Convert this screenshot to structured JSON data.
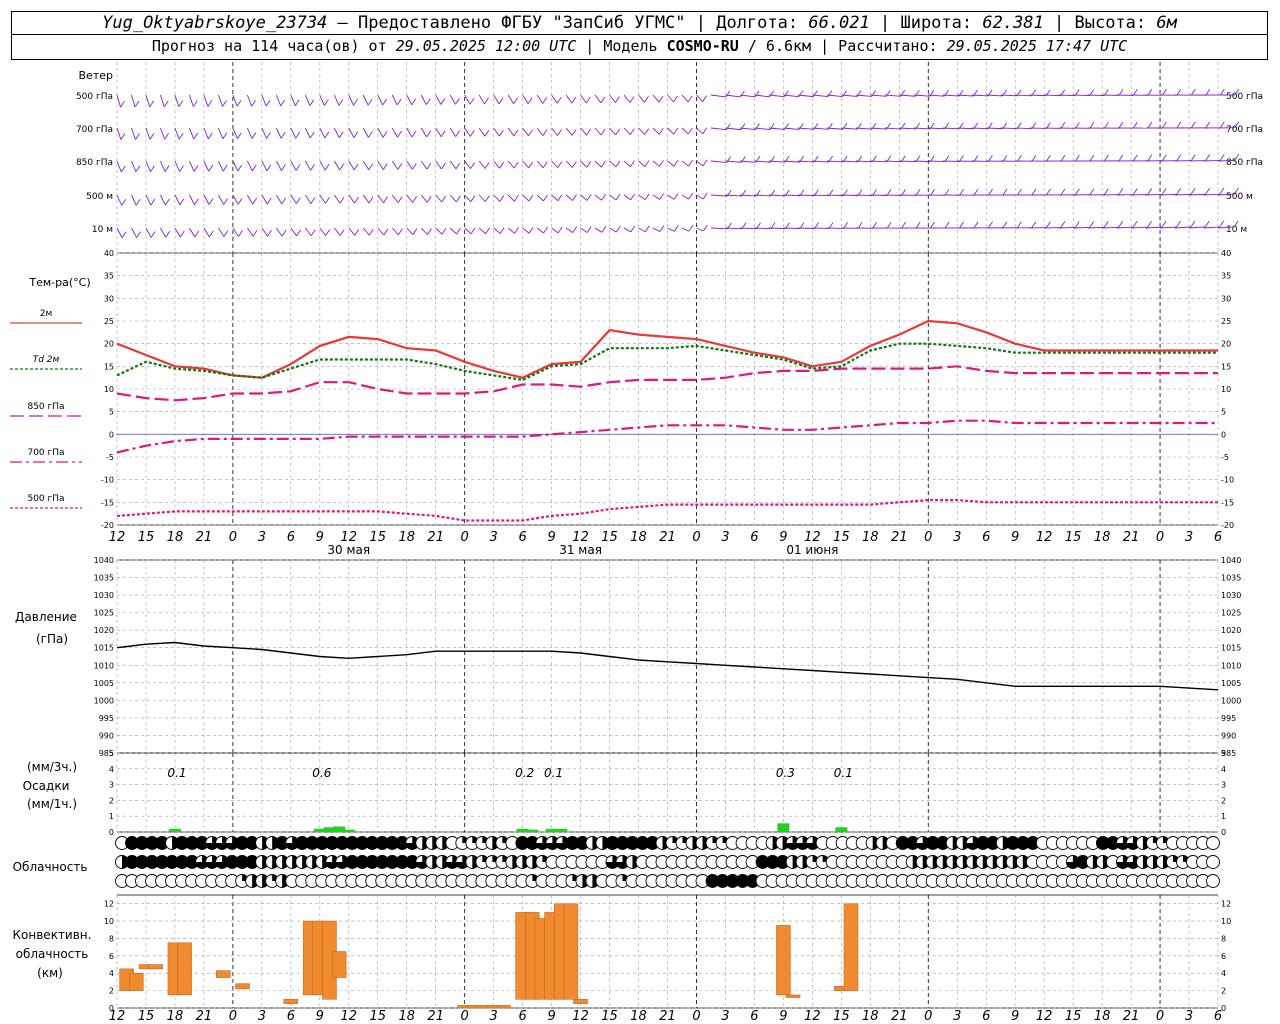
{
  "header": {
    "station": "Yug_Oktyabrskoye_23734",
    "provided_label": " – Предоставлено ФГБУ \"ЗапСиб УГМС\" | Долгота: ",
    "lon": "66.021",
    "lat_label": " | Широта: ",
    "lat": "62.381",
    "alt_label": " | Высота: ",
    "alt": "6м",
    "forecast_label": "Прогноз на 114 часа(ов) от ",
    "forecast_time": "29.05.2025 12:00 UTC",
    "model_label": " | Модель ",
    "model": "COSMO-RU",
    "resolution": " / 6.6км",
    "computed_label": " | Рассчитано: ",
    "computed_time": "29.05.2025 17:47 UTC"
  },
  "colors": {
    "t2m": "#e8393a",
    "td2m": "#117711",
    "t850": "#e0187a",
    "t700": "#e0187a",
    "t500": "#e0187a",
    "wind": "#8a1ec8",
    "pressure": "#000000",
    "precip": "#22d022",
    "convective": "#f08a30",
    "grid": "#a0a0a0"
  },
  "chart_data": [
    {
      "type": "wind-barbs",
      "title": "Ветер",
      "levels": [
        "500 гПа",
        "700 гПа",
        "850 гПа",
        "500 м",
        "10 м"
      ]
    },
    {
      "type": "line",
      "ylabel": "Тем-ра(°C)",
      "ylim": [
        -20,
        40
      ],
      "yticks": [
        -20,
        -15,
        -10,
        -5,
        0,
        5,
        10,
        15,
        20,
        25,
        30,
        35,
        40
      ],
      "x_hours": [
        0,
        3,
        6,
        9,
        12,
        15,
        18,
        21,
        24,
        27,
        30,
        33,
        36,
        39,
        42,
        45,
        48,
        51,
        54,
        57,
        60,
        63,
        66,
        69,
        72,
        75,
        78,
        81,
        84,
        87,
        90,
        93,
        96,
        99,
        102,
        105,
        108,
        111,
        114
      ],
      "tick_labels": [
        "12",
        "15",
        "18",
        "21",
        "0",
        "3",
        "6",
        "9",
        "12",
        "15",
        "18",
        "21",
        "0",
        "3",
        "6",
        "9",
        "12",
        "15",
        "18",
        "21",
        "0",
        "3",
        "6",
        "9",
        "12",
        "15",
        "18",
        "21",
        "0",
        "3",
        "6",
        "9",
        "12",
        "15",
        "18",
        "21",
        "0",
        "3",
        "6",
        "9",
        "12",
        "15",
        "18"
      ],
      "day_labels": [
        "30 мая",
        "31 мая",
        "01 июня"
      ],
      "series": [
        {
          "name": "2м",
          "style": "solid",
          "values": [
            20,
            17.5,
            15,
            14.5,
            13,
            12.5,
            15.5,
            19.5,
            21.5,
            21,
            19,
            18.5,
            16,
            14,
            12.5,
            15.5,
            16,
            23,
            22,
            21.5,
            21,
            19.5,
            18,
            17,
            15,
            16,
            19.5,
            22,
            25,
            24.5,
            22.5,
            20,
            18.5,
            18.5,
            18.5,
            18.5,
            18.5,
            18.5,
            18.5
          ]
        },
        {
          "name": "Td 2м",
          "style": "dotted",
          "values": [
            13,
            16,
            14.5,
            14,
            13,
            12.5,
            14.5,
            16.5,
            16.5,
            16.5,
            16.5,
            15.5,
            14,
            13,
            12,
            15,
            15.5,
            19,
            19,
            19,
            19.5,
            18.5,
            17.5,
            16.5,
            14.5,
            15,
            18.5,
            20,
            20,
            19.5,
            19,
            18,
            18,
            18,
            18,
            18,
            18,
            18,
            18
          ]
        },
        {
          "name": "850 гПа",
          "style": "dashed",
          "values": [
            9,
            8,
            7.5,
            8,
            9,
            9,
            9.5,
            11.5,
            11.5,
            10,
            9,
            9,
            9,
            9.5,
            11,
            11,
            10.5,
            11.5,
            12,
            12,
            12,
            12.5,
            13.5,
            14,
            14,
            14.5,
            14.5,
            14.5,
            14.5,
            15,
            14,
            13.5,
            13.5,
            13.5,
            13.5,
            13.5,
            13.5,
            13.5,
            13.5
          ]
        },
        {
          "name": "700 гПа",
          "style": "dashdot",
          "values": [
            -4,
            -2.5,
            -1.5,
            -1,
            -1,
            -1,
            -1,
            -1,
            -0.5,
            -0.5,
            -0.5,
            -0.5,
            -0.5,
            -0.5,
            -0.5,
            0,
            0.5,
            1,
            1.5,
            2,
            2,
            2,
            1.5,
            1,
            1,
            1.5,
            2,
            2.5,
            2.5,
            3,
            3,
            2.5,
            2.5,
            2.5,
            2.5,
            2.5,
            2.5,
            2.5,
            2.5
          ]
        },
        {
          "name": "500 гПа",
          "style": "dotted",
          "values": [
            -18,
            -17.5,
            -17,
            -17,
            -17,
            -17,
            -17,
            -17,
            -17,
            -17,
            -17.5,
            -18,
            -19,
            -19,
            -19,
            -18,
            -17.5,
            -16.5,
            -16,
            -15.5,
            -15.5,
            -15.5,
            -15.5,
            -15.5,
            -15.5,
            -15.5,
            -15.5,
            -15,
            -14.5,
            -14.5,
            -15,
            -15,
            -15,
            -15,
            -15,
            -15,
            -15,
            -15,
            -15
          ]
        }
      ]
    },
    {
      "type": "line",
      "title": "Давление",
      "ylabel": "(гПа)",
      "ylim": [
        985,
        1040
      ],
      "yticks": [
        985,
        990,
        995,
        1000,
        1005,
        1010,
        1015,
        1020,
        1025,
        1030,
        1035,
        1040
      ],
      "x_hours": [
        0,
        3,
        6,
        9,
        12,
        15,
        18,
        21,
        24,
        27,
        30,
        33,
        36,
        39,
        42,
        45,
        48,
        51,
        54,
        57,
        60,
        63,
        66,
        69,
        72,
        75,
        78,
        81,
        84,
        87,
        90,
        93,
        96,
        99,
        102,
        105,
        108,
        111,
        114
      ],
      "series": [
        {
          "name": "Давление",
          "values": [
            1015,
            1016,
            1016.5,
            1015.5,
            1015,
            1014.5,
            1013.5,
            1012.5,
            1012,
            1012.5,
            1013,
            1014,
            1014,
            1014,
            1014,
            1014,
            1013.5,
            1012.5,
            1011.5,
            1011,
            1010.5,
            1010,
            1009.5,
            1009,
            1008.5,
            1008,
            1007.5,
            1007,
            1006.5,
            1006,
            1005,
            1004,
            1004,
            1004,
            1004,
            1004,
            1004,
            1003.5,
            1003
          ]
        }
      ]
    },
    {
      "type": "bar",
      "title": "Осадки",
      "ylabel": "(мм/3ч.)",
      "ylabel2": "(мм/1ч.)",
      "ylim": [
        0,
        5
      ],
      "yticks": [
        0,
        1,
        2,
        3,
        4,
        5
      ],
      "totals": [
        {
          "hour": 6,
          "label": "0.1"
        },
        {
          "hour": 21,
          "label": "0.6"
        },
        {
          "hour": 42,
          "label": "0.2"
        },
        {
          "hour": 45,
          "label": "0.1"
        },
        {
          "hour": 69,
          "label": "0.3"
        },
        {
          "hour": 75,
          "label": "0.1"
        }
      ],
      "bars": [
        {
          "hour": 6,
          "value": 0.2
        },
        {
          "hour": 21,
          "value": 0.2
        },
        {
          "hour": 22,
          "value": 0.3
        },
        {
          "hour": 23,
          "value": 0.35
        },
        {
          "hour": 24,
          "value": 0.15
        },
        {
          "hour": 42,
          "value": 0.2
        },
        {
          "hour": 43,
          "value": 0.15
        },
        {
          "hour": 45,
          "value": 0.2
        },
        {
          "hour": 46,
          "value": 0.2
        },
        {
          "hour": 69,
          "value": 0.55
        },
        {
          "hour": 75,
          "value": 0.3
        }
      ]
    },
    {
      "type": "cloud-symbols",
      "title": "Облачность",
      "rows": 3,
      "note": "octa coverage per column (high, middle, low)",
      "high": [
        0,
        8,
        8,
        8,
        8,
        4,
        8,
        8,
        8,
        6,
        6,
        6,
        8,
        8,
        4,
        4,
        8,
        6,
        8,
        8,
        8,
        8,
        8,
        8,
        8,
        8,
        8,
        8,
        8,
        6,
        4,
        4,
        4,
        0,
        2,
        2,
        2,
        4,
        2,
        0,
        8,
        8,
        6,
        6,
        6,
        8,
        8,
        4,
        4,
        8,
        8,
        8,
        8,
        8,
        4,
        2,
        2,
        4,
        4,
        2,
        2,
        0,
        0,
        0,
        0,
        4,
        4,
        6,
        6,
        6,
        0,
        0,
        0,
        0,
        0,
        4,
        4,
        0,
        8,
        8,
        6,
        8,
        8,
        4,
        4,
        6,
        8,
        8,
        4,
        8,
        8,
        8,
        0,
        0,
        0,
        0,
        0,
        0,
        8,
        8,
        6,
        6,
        4,
        2,
        2,
        0,
        0,
        0
      ],
      "middle": [
        4,
        8,
        8,
        8,
        8,
        8,
        8,
        8,
        6,
        6,
        6,
        8,
        8,
        8,
        4,
        4,
        4,
        4,
        4,
        4,
        4,
        6,
        6,
        8,
        8,
        8,
        8,
        8,
        8,
        8,
        6,
        4,
        4,
        6,
        6,
        4,
        2,
        2,
        2,
        4,
        4,
        4,
        2,
        0,
        0,
        0,
        0,
        0,
        0,
        6,
        6,
        4,
        0,
        0,
        0,
        0,
        0,
        0,
        0,
        0,
        0,
        0,
        0,
        0,
        8,
        8,
        8,
        4,
        4,
        2,
        2,
        0,
        0,
        0,
        0,
        0,
        0,
        0,
        0,
        4,
        4,
        4,
        4,
        4,
        4,
        4,
        4,
        4,
        4,
        4,
        4,
        0,
        0,
        0,
        0,
        6,
        8,
        4,
        4,
        0,
        6,
        6,
        4,
        4,
        4,
        2,
        2,
        0,
        0,
        0
      ],
      "low": [
        0,
        0,
        0,
        0,
        0,
        0,
        0,
        0,
        0,
        0,
        0,
        0,
        2,
        4,
        4,
        2,
        4,
        0,
        0,
        0,
        0,
        0,
        0,
        0,
        0,
        0,
        0,
        0,
        0,
        0,
        0,
        0,
        0,
        0,
        0,
        0,
        0,
        0,
        0,
        0,
        0,
        2,
        0,
        0,
        0,
        2,
        4,
        4,
        0,
        0,
        2,
        0,
        0,
        0,
        0,
        0,
        0,
        0,
        0,
        8,
        8,
        8,
        8,
        8,
        0,
        0,
        0,
        0,
        0,
        0,
        0,
        0,
        0,
        0,
        0,
        0,
        0,
        0,
        0,
        0,
        0,
        0,
        0,
        0,
        0,
        0,
        0,
        0,
        0,
        0,
        0,
        0,
        0,
        0,
        0,
        0,
        0,
        0,
        0,
        0,
        0,
        0,
        0,
        0,
        0,
        0,
        0,
        0,
        0,
        0
      ]
    },
    {
      "type": "bar",
      "title": "Конвективн. облачность",
      "ylabel": "(км)",
      "ylim": [
        0,
        13
      ],
      "yticks": [
        0,
        2,
        4,
        6,
        8,
        10,
        12
      ],
      "bars": [
        {
          "hour": 1,
          "base": 2,
          "top": 4.5
        },
        {
          "hour": 2,
          "base": 2,
          "top": 4
        },
        {
          "hour": 3,
          "base": 4.5,
          "top": 5
        },
        {
          "hour": 4,
          "base": 4.5,
          "top": 5
        },
        {
          "hour": 6,
          "base": 1.5,
          "top": 7.5
        },
        {
          "hour": 7,
          "base": 1.5,
          "top": 7.5
        },
        {
          "hour": 11,
          "base": 3.5,
          "top": 4.3
        },
        {
          "hour": 13,
          "base": 2.2,
          "top": 2.8
        },
        {
          "hour": 18,
          "base": 0.5,
          "top": 1
        },
        {
          "hour": 20,
          "base": 1.5,
          "top": 10
        },
        {
          "hour": 21,
          "base": 1.5,
          "top": 10
        },
        {
          "hour": 22,
          "base": 1,
          "top": 10
        },
        {
          "hour": 23,
          "base": 3.5,
          "top": 6.5
        },
        {
          "hour": 36,
          "base": 0,
          "top": 0.3
        },
        {
          "hour": 37,
          "base": 0,
          "top": 0.3
        },
        {
          "hour": 38,
          "base": 0,
          "top": 0.3
        },
        {
          "hour": 39,
          "base": 0,
          "top": 0.3
        },
        {
          "hour": 40,
          "base": 0,
          "top": 0.3
        },
        {
          "hour": 42,
          "base": 1,
          "top": 11
        },
        {
          "hour": 43,
          "base": 1,
          "top": 11
        },
        {
          "hour": 44,
          "base": 1,
          "top": 10.3
        },
        {
          "hour": 45,
          "base": 1,
          "top": 11
        },
        {
          "hour": 46,
          "base": 1,
          "top": 12
        },
        {
          "hour": 47,
          "base": 1,
          "top": 12
        },
        {
          "hour": 48,
          "base": 0.5,
          "top": 1
        },
        {
          "hour": 69,
          "base": 1.5,
          "top": 9.5
        },
        {
          "hour": 70,
          "base": 1.2,
          "top": 1.5
        },
        {
          "hour": 75,
          "base": 2,
          "top": 2.5
        },
        {
          "hour": 76,
          "base": 2,
          "top": 12
        }
      ]
    }
  ],
  "labels": {
    "wind_title": "Ветер",
    "temp_title": "Тем-ра(°C)",
    "legend": [
      "2м",
      "Td  2м",
      "850 гПа",
      "700 гПа",
      "500 гПа"
    ],
    "pressure_title": "Давление",
    "pressure_unit": "(гПа)",
    "precip_unit3": "(мм/3ч.)",
    "precip_title": "Осадки",
    "precip_unit1": "(мм/1ч.)",
    "cloud_title": "Облачность",
    "conv_title1": "Конвективн.",
    "conv_title2": "облачность",
    "conv_unit": "(км)"
  }
}
